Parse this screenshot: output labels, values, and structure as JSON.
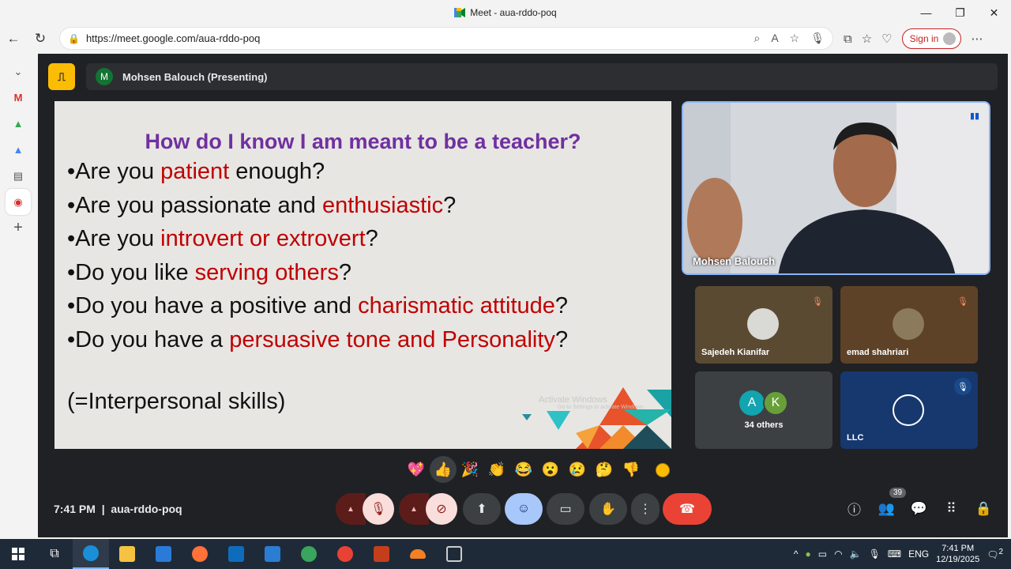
{
  "window": {
    "title": "Meet - aua-rddo-poq",
    "minimize": "—",
    "maximize": "❐",
    "close": "✕"
  },
  "browser": {
    "url": "https://meet.google.com/aua-rddo-poq",
    "signin_label": "Sign in"
  },
  "meet": {
    "presenting_initial": "M",
    "presenting_label": "Mohsen Balouch (Presenting)",
    "slide": {
      "heading": "How do I know I am meant to be a teacher?",
      "bullets": [
        {
          "pre": "•Are you ",
          "hl": "patient",
          "post": " enough?"
        },
        {
          "pre": "•Are you passionate and ",
          "hl": "enthusiastic",
          "post": "?"
        },
        {
          "pre": "•Are you ",
          "hl": "introvert or extrovert",
          "post": "?"
        },
        {
          "pre": "•Do you like ",
          "hl": "serving others",
          "post": "?"
        },
        {
          "pre": "•Do you have a positive and ",
          "hl": "charismatic attitude",
          "post": "?"
        },
        {
          "pre": "•Do you have a ",
          "hl": "persuasive tone and Personality",
          "post": "?"
        }
      ],
      "footer": "(=Interpersonal skills)",
      "watermark_line1": "Activate Windows",
      "watermark_line2": "Go to Settings to activate Windows."
    },
    "main_speaker": {
      "name": "Mohsen Balouch"
    },
    "tiles": [
      {
        "name": "Sajedeh Kianifar"
      },
      {
        "name": "emad shahriari"
      },
      {
        "name": "34 others",
        "avatar_a": "A",
        "avatar_b": "K"
      },
      {
        "name": "LLC"
      }
    ],
    "reactions": [
      "💖",
      "👍",
      "🎉",
      "👏",
      "😂",
      "😮",
      "😢",
      "🤔",
      "👎"
    ],
    "clock": "7:41 PM",
    "separator": "|",
    "meeting_code": "aua-rddo-poq",
    "people_count": "39"
  },
  "taskbar": {
    "lang": "ENG",
    "time": "7:41 PM",
    "date": "12/19/2025",
    "notif_count": "2"
  }
}
